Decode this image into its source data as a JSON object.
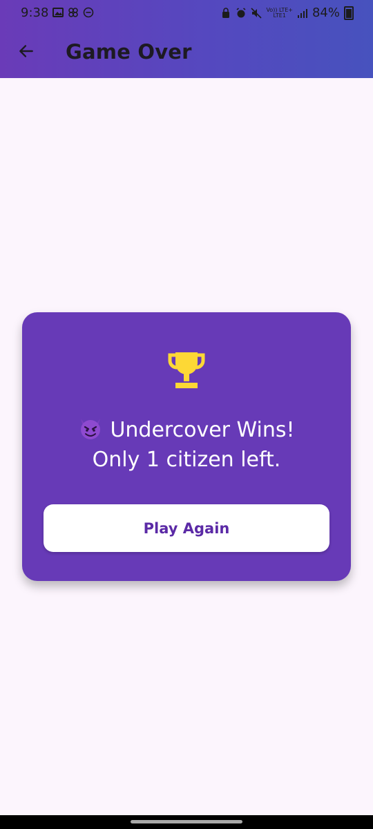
{
  "status_bar": {
    "time": "9:38",
    "network_top": "Vo)) LTE+",
    "network_bottom": "LTE1",
    "battery": "84%"
  },
  "app_bar": {
    "title": "Game Over",
    "back_icon": "arrow-left-icon"
  },
  "result_card": {
    "icon": "trophy-icon",
    "emoji": "smiling-devil-emoji",
    "headline": "Undercover Wins!",
    "subtitle": "Only 1 citizen left.",
    "play_again_label": "Play Again"
  },
  "colors": {
    "card_bg": "#673ab7",
    "page_bg": "#fcf5fd",
    "trophy": "#fdd835",
    "button_text": "#5b2aa6"
  }
}
